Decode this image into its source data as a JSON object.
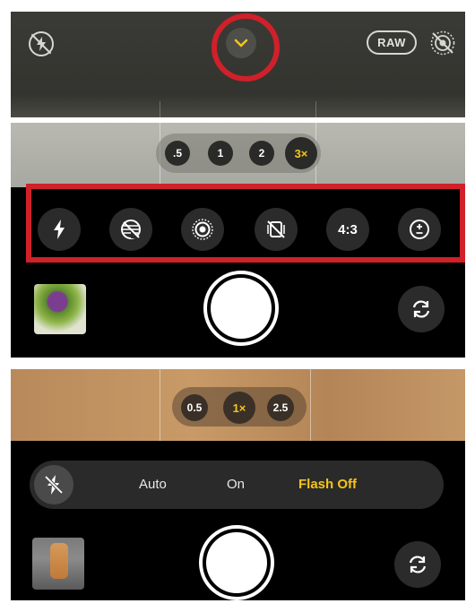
{
  "panel_top": {
    "raw_label": "RAW",
    "icons": [
      "flash-off-icon",
      "chevron-down-icon",
      "live-photo-off-icon"
    ],
    "highlight_color": "#d0202a",
    "chevron_color": "#f5c518"
  },
  "panel_controls": {
    "zoom_levels": [
      ".5",
      "1",
      "2",
      "3×"
    ],
    "active_zoom": "3×",
    "controls": [
      {
        "icon": "flash-icon"
      },
      {
        "icon": "night-mode-icon"
      },
      {
        "icon": "live-photo-icon"
      },
      {
        "icon": "styles-off-icon"
      },
      {
        "icon": "aspect-ratio",
        "label": "4:3"
      },
      {
        "icon": "exposure-icon"
      }
    ],
    "highlight_color": "#d0202a"
  },
  "panel_flash": {
    "zoom_levels": [
      "0.5",
      "1×",
      "2.5"
    ],
    "active_zoom": "1×",
    "flash_options": [
      "Auto",
      "On",
      "Flash Off"
    ],
    "selected_option": "Flash Off",
    "accent_color": "#f5c518"
  }
}
